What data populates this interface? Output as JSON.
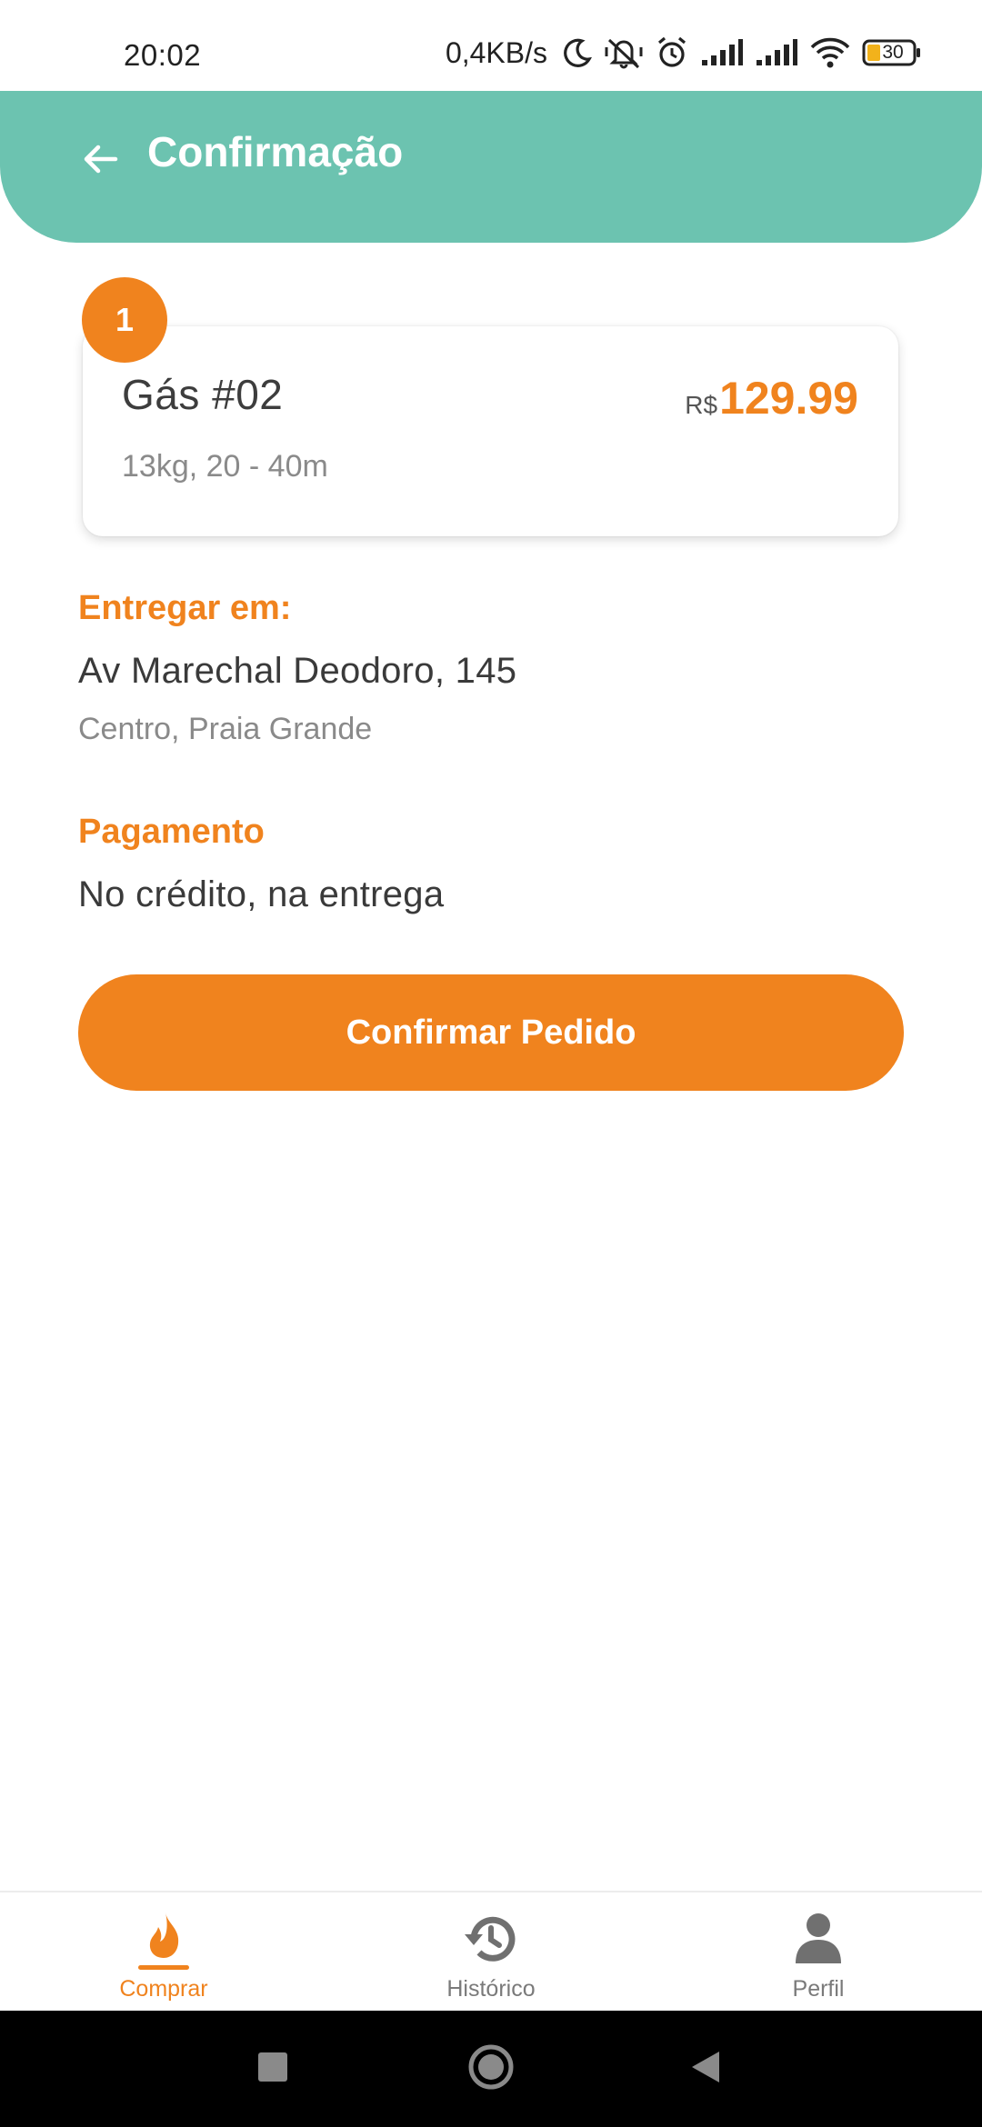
{
  "status_bar": {
    "time": "20:02",
    "net_speed": "0,4KB/s",
    "battery": "30",
    "icons": [
      "moon-icon",
      "mute-icon",
      "alarm-icon",
      "signal-icon",
      "signal-icon",
      "wifi-icon",
      "battery-icon"
    ]
  },
  "header": {
    "title": "Confirmação",
    "back_icon": "arrow-left-icon"
  },
  "order": {
    "quantity": "1",
    "product_name": "Gás #02",
    "details": "13kg, 20 - 40m",
    "currency": "R$",
    "price": "129.99"
  },
  "delivery": {
    "label": "Entregar em:",
    "address": "Av Marechal Deodoro, 145",
    "neighborhood": "Centro, Praia Grande"
  },
  "payment": {
    "label": "Pagamento",
    "method": "No crédito, na entrega"
  },
  "actions": {
    "confirm_label": "Confirmar Pedido"
  },
  "bottom_nav": {
    "items": [
      {
        "label": "Comprar",
        "icon": "flame-icon",
        "active": true
      },
      {
        "label": "Histórico",
        "icon": "history-icon",
        "active": false
      },
      {
        "label": "Perfil",
        "icon": "person-icon",
        "active": false
      }
    ]
  },
  "colors": {
    "header": "#6cc3b0",
    "accent": "#f0831e",
    "text": "#3a3a3a",
    "muted": "#8a8a8a"
  }
}
